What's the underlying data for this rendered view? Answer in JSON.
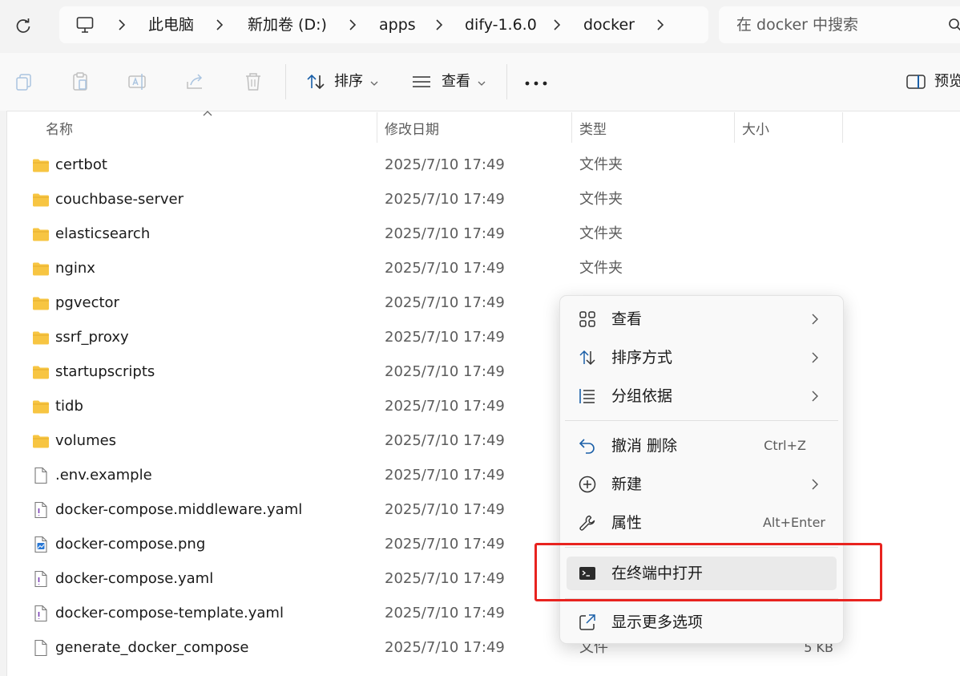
{
  "address_bar": {
    "crumbs": [
      "此电脑",
      "新加卷 (D:)",
      "apps",
      "dify-1.6.0",
      "docker"
    ],
    "search_placeholder": "在 docker 中搜索"
  },
  "toolbar": {
    "sort_label": "排序",
    "view_label": "查看",
    "preview_label": "预览"
  },
  "columns": {
    "name": "名称",
    "modified": "修改日期",
    "type": "类型",
    "size": "大小"
  },
  "files": [
    {
      "name": "certbot",
      "date": "2025/7/10 17:49",
      "type": "文件夹",
      "icon": "folder-icon"
    },
    {
      "name": "couchbase-server",
      "date": "2025/7/10 17:49",
      "type": "文件夹",
      "icon": "folder-icon"
    },
    {
      "name": "elasticsearch",
      "date": "2025/7/10 17:49",
      "type": "文件夹",
      "icon": "folder-icon"
    },
    {
      "name": "nginx",
      "date": "2025/7/10 17:49",
      "type": "文件夹",
      "icon": "folder-icon"
    },
    {
      "name": "pgvector",
      "date": "2025/7/10 17:49",
      "type": "",
      "icon": "folder-icon"
    },
    {
      "name": "ssrf_proxy",
      "date": "2025/7/10 17:49",
      "type": "",
      "icon": "folder-icon"
    },
    {
      "name": "startupscripts",
      "date": "2025/7/10 17:49",
      "type": "",
      "icon": "folder-icon"
    },
    {
      "name": "tidb",
      "date": "2025/7/10 17:49",
      "type": "",
      "icon": "folder-icon"
    },
    {
      "name": "volumes",
      "date": "2025/7/10 17:49",
      "type": "",
      "icon": "folder-icon"
    },
    {
      "name": ".env.example",
      "date": "2025/7/10 17:49",
      "type": "",
      "icon": "file-icon"
    },
    {
      "name": "docker-compose.middleware.yaml",
      "date": "2025/7/10 17:49",
      "type": "",
      "icon": "yaml-file-icon"
    },
    {
      "name": "docker-compose.png",
      "date": "2025/7/10 17:49",
      "type": "",
      "icon": "image-file-icon"
    },
    {
      "name": "docker-compose.yaml",
      "date": "2025/7/10 17:49",
      "type": "",
      "icon": "yaml-file-icon"
    },
    {
      "name": "docker-compose-template.yaml",
      "date": "2025/7/10 17:49",
      "type": "",
      "icon": "yaml-file-icon"
    },
    {
      "name": "generate_docker_compose",
      "date": "2025/7/10 17:49",
      "type": "文件",
      "size": "5 KB",
      "icon": "file-icon"
    }
  ],
  "context_menu": {
    "view": "查看",
    "sort_by": "排序方式",
    "group_by": "分组依据",
    "undo_delete": "撤消 删除",
    "undo_shortcut": "Ctrl+Z",
    "new": "新建",
    "properties": "属性",
    "properties_shortcut": "Alt+Enter",
    "open_in_terminal": "在终端中打开",
    "show_more_options": "显示更多选项"
  },
  "colors": {
    "folder": "#f7c542",
    "highlight_box": "#e8231f",
    "accent": "#005fb8"
  }
}
